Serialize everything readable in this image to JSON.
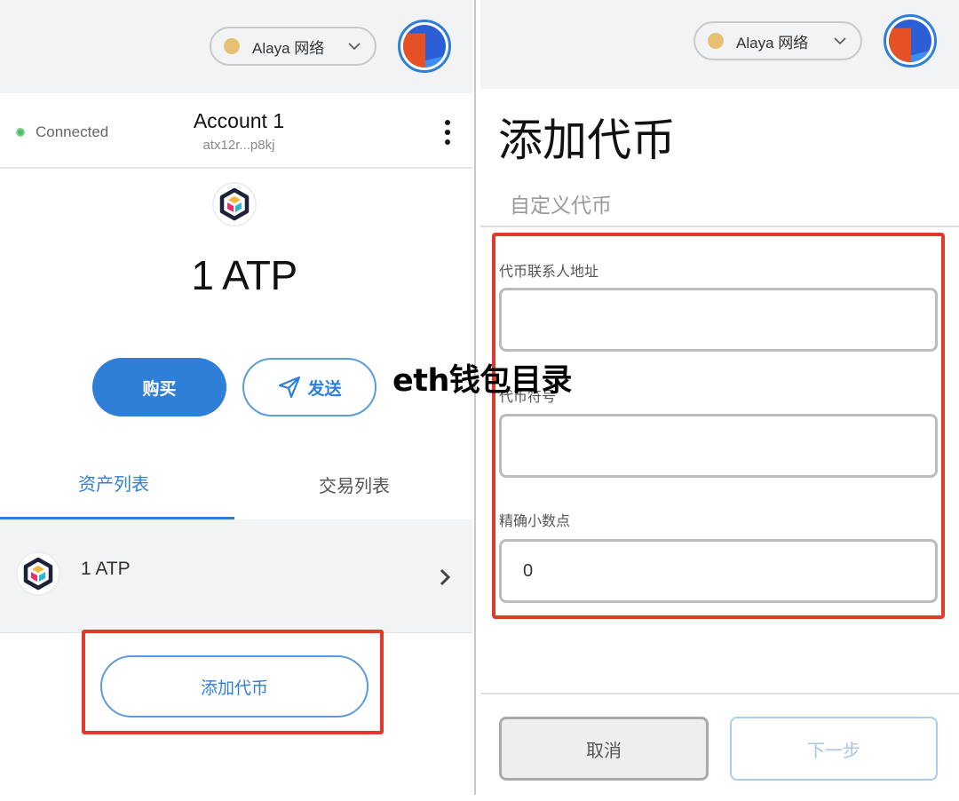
{
  "colors": {
    "accent": "#2f7fd8",
    "highlight": "#e03a2b",
    "network_dot": "#e6c173",
    "connected": "#4fbf65",
    "header_bg": "#f2f3f4"
  },
  "left_panel": {
    "header": {
      "network_label": "Alaya 网络",
      "network_icon": "network-status-dot",
      "dropdown_icon": "chevron-down-icon",
      "avatar_icon": "account-identicon"
    },
    "account": {
      "status": "Connected",
      "name": "Account 1",
      "address": "atx12r...p8kj",
      "menu_icon": "kebab-menu-icon"
    },
    "balance": {
      "token_icon": "alaya-token-icon",
      "amount": "1 ATP"
    },
    "actions": {
      "buy_label": "购买",
      "send_label": "发送",
      "send_icon": "paper-plane-icon"
    },
    "tabs": [
      {
        "label": "资产列表",
        "active": true
      },
      {
        "label": "交易列表",
        "active": false
      }
    ],
    "assets": [
      {
        "amount": "1 ATP",
        "icon": "alaya-token-icon",
        "chevron": "chevron-right-icon"
      }
    ],
    "add_token_label": "添加代币"
  },
  "right_panel": {
    "header": {
      "network_label": "Alaya 网络",
      "network_icon": "network-status-dot",
      "dropdown_icon": "chevron-down-icon",
      "avatar_icon": "account-identicon"
    },
    "title": "添加代币",
    "subtab": "自定义代币",
    "form": {
      "address_label": "代币联系人地址",
      "address_value": "",
      "symbol_label": "代币符号",
      "symbol_value": "",
      "decimals_label": "精确小数点",
      "decimals_value": "0"
    },
    "footer": {
      "cancel_label": "取消",
      "next_label": "下一步"
    }
  },
  "watermark": "eth钱包目录"
}
